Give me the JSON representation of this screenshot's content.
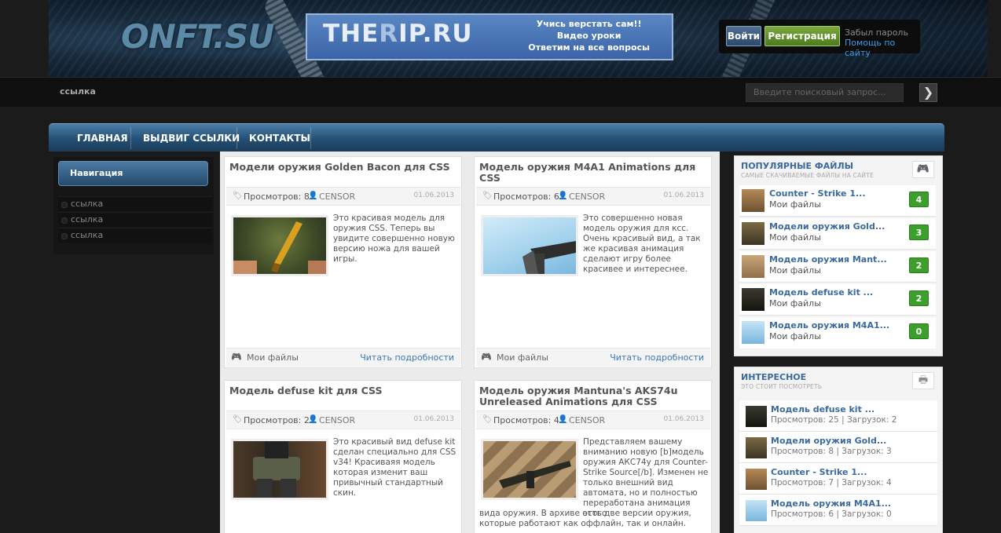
{
  "header": {
    "logo": "ONFT.SU",
    "banner_main_a": "THE",
    "banner_main_b": "R",
    "banner_main_c": "IP.RU",
    "banner_line1": "Учись верстать сам!!",
    "banner_line2": "Видео уроки",
    "banner_line3": "Ответим на все вопросы",
    "login_label": "Войти",
    "register_label": "Регистрация",
    "forgot_label": "Забыл пароль",
    "help_label": "Помощь по сайту"
  },
  "subbar": {
    "link": "ссылка",
    "search_placeholder": "Введите поисковый запрос...",
    "search_go": "❯"
  },
  "nav": {
    "items": [
      "ГЛАВНАЯ",
      "ВЫДВИГ ССЫЛКИ",
      "КОНТАКТЫ"
    ]
  },
  "left": {
    "heading": "Навигация",
    "links": [
      "ссылка",
      "ссылка",
      "ссылка"
    ]
  },
  "cards": [
    {
      "title": "Модели оружия Golden Bacon для CSS",
      "views": "Просмотров: 8",
      "user": "CENSOR",
      "date": "01.06.2013",
      "desc": "Это красивая модель для оружия CSS. Теперь вы увидите совершенно новую версию ножа для вашей игры.",
      "category": "Мои файлы",
      "more": "Читать подробности"
    },
    {
      "title": "Модель оружия M4A1 Animations для CSS",
      "views": "Просмотров: 6",
      "user": "CENSOR",
      "date": "01.06.2013",
      "desc": "Это совершенно новая модель оружия для ксс. Очень красивый вид, а так же красивая анимация сделают игру более красивее и интереснее.",
      "category": "Мои файлы",
      "more": "Читать подробности"
    },
    {
      "title": "Модель defuse kit для CSS",
      "views": "Просмотров: 25",
      "user": "CENSOR",
      "date": "01.06.2013",
      "desc": "Это красивый вид defuse kit сделан специально для CSS v34! Красиваяя модель которая изменит ваш привычный стандартный скин."
    },
    {
      "title": "Модель оружия Mantuna's AKS74u Unreleased Animations для CSS",
      "views": "Просмотров: 4",
      "user": "CENSOR",
      "date": "01.06.2013",
      "desc_a": "Представляем вашему вниманию новую [b]модель оружия АКС74у для Counter-Strike Source[/b]. Изменен не только внешний вид автомата, но и полностью переработана анимация этого",
      "desc_b": "вида оружия. В архиве есть две версии оружия, которые работают как оффлайн, так и онлайн."
    }
  ],
  "popular": {
    "title": "ПОПУЛЯРНЫЕ ФАЙЛЫ",
    "subtitle": "САМЫЕ СКАЧИВАЕМЫЕ ФАЙЛЫ НА САЙТЕ",
    "items": [
      {
        "title": "Counter - Strike 1...",
        "cat": "Мои файлы",
        "count": "4"
      },
      {
        "title": "Модели оружия Gold...",
        "cat": "Мои файлы",
        "count": "3"
      },
      {
        "title": "Модель оружия Mant...",
        "cat": "Мои файлы",
        "count": "2"
      },
      {
        "title": "Модель defuse kit ...",
        "cat": "Мои файлы",
        "count": "2"
      },
      {
        "title": "Модель оружия M4A1...",
        "cat": "Мои файлы",
        "count": "0"
      }
    ]
  },
  "interesting": {
    "title": "ИНТЕРЕСНОЕ",
    "subtitle": "ЭТО СТОИТ ПОСМОТРЕТЬ",
    "items": [
      {
        "title": "Модель defuse kit ...",
        "stats": "Просмотров: 25 | Загрузок: 2"
      },
      {
        "title": "Модели оружия Gold...",
        "stats": "Просмотров: 8 | Загрузок: 3"
      },
      {
        "title": "Counter - Strike 1...",
        "stats": "Просмотров: 7 | Загрузок: 4"
      },
      {
        "title": "Модель оружия M4A1...",
        "stats": "Просмотров: 6 | Загрузок: 0"
      }
    ]
  },
  "icons": {
    "gamepad": "gamepad-icon",
    "printer": "printer-icon",
    "tag": "tag-icon",
    "user": "user-icon"
  }
}
